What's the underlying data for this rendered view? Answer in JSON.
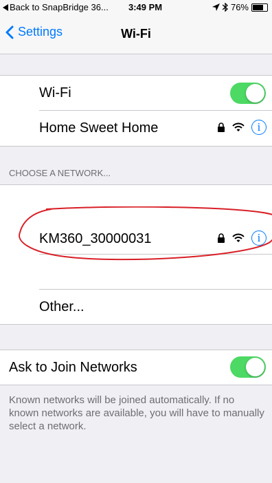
{
  "status_bar": {
    "back_app_label": "Back to SnapBridge 36...",
    "time": "3:49 PM",
    "battery_percent": "76%",
    "battery_level": 0.76,
    "icons": [
      "back-triangle-icon",
      "location-arrow-icon",
      "bluetooth-icon",
      "battery-icon"
    ]
  },
  "nav": {
    "back_label": "Settings",
    "title": "Wi-Fi"
  },
  "wifi": {
    "label": "Wi-Fi",
    "enabled": true,
    "connected_network": "Home Sweet Home"
  },
  "networks": {
    "header": "CHOOSE A NETWORK...",
    "items": [
      {
        "name": "KM360_30000031",
        "secured": true
      }
    ],
    "other_label": "Other..."
  },
  "ask_to_join": {
    "label": "Ask to Join Networks",
    "enabled": true,
    "footer": "Known networks will be joined automatically. If no known networks are available, you will have to manually select a network."
  },
  "colors": {
    "tint": "#007aff",
    "toggle_on": "#4cd964",
    "annotation": "#d81f26"
  }
}
